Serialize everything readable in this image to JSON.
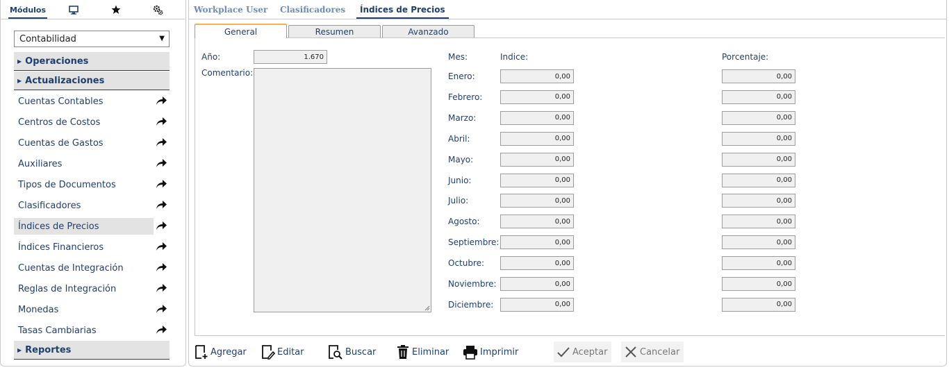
{
  "left_tabs": {
    "modules_label": "Módulos"
  },
  "module_select": {
    "value": "Contabilidad"
  },
  "sections": {
    "operaciones": "Operaciones",
    "actualizaciones": "Actualizaciones",
    "reportes": "Reportes"
  },
  "menu_items": [
    "Cuentas Contables",
    "Centros de Costos",
    "Cuentas de Gastos",
    "Auxiliares",
    "Tipos de Documentos",
    "Clasificadores",
    "Índices de Precios",
    "Índices Financieros",
    "Cuentas de Integración",
    "Reglas de Integración",
    "Monedas",
    "Tasas Cambiarias"
  ],
  "top_tabs": [
    "Workplace User",
    "Clasificadores",
    "Índices de Precios"
  ],
  "sub_tabs": [
    "General",
    "Resumen",
    "Avanzado"
  ],
  "form": {
    "anio_label": "Año:",
    "anio_value": "1.670",
    "comentario_label": "Comentario:",
    "mes_label": "Mes:",
    "indice_label": "Indice:",
    "porcentaje_label": "Porcentaje:"
  },
  "months": [
    {
      "name": "Enero:",
      "indice": "0,00",
      "porcentaje": "0,00"
    },
    {
      "name": "Febrero:",
      "indice": "0,00",
      "porcentaje": "0,00"
    },
    {
      "name": "Marzo:",
      "indice": "0,00",
      "porcentaje": "0,00"
    },
    {
      "name": "Abril:",
      "indice": "0,00",
      "porcentaje": "0,00"
    },
    {
      "name": "Mayo:",
      "indice": "0,00",
      "porcentaje": "0,00"
    },
    {
      "name": "Junio:",
      "indice": "0,00",
      "porcentaje": "0,00"
    },
    {
      "name": "Julio:",
      "indice": "0,00",
      "porcentaje": "0,00"
    },
    {
      "name": "Agosto:",
      "indice": "0,00",
      "porcentaje": "0,00"
    },
    {
      "name": "Septiembre:",
      "indice": "0,00",
      "porcentaje": "0,00"
    },
    {
      "name": "Octubre:",
      "indice": "0,00",
      "porcentaje": "0,00"
    },
    {
      "name": "Noviembre:",
      "indice": "0,00",
      "porcentaje": "0,00"
    },
    {
      "name": "Diciembre:",
      "indice": "0,00",
      "porcentaje": "0,00"
    }
  ],
  "toolbar": {
    "add": "Agregar",
    "edit": "Editar",
    "search": "Buscar",
    "delete": "Eliminar",
    "print": "Imprimir",
    "accept": "Aceptar",
    "cancel": "Cancelar"
  },
  "icons": {
    "monitor": "monitor-icon",
    "star": "star-icon",
    "settings": "gears-icon",
    "menu_arrow": "share-arrow-icon"
  },
  "colors": {
    "accent": "#1f3f6d",
    "tab_highlight": "#f2b34c",
    "inactive_tab": "#6d8db6"
  }
}
